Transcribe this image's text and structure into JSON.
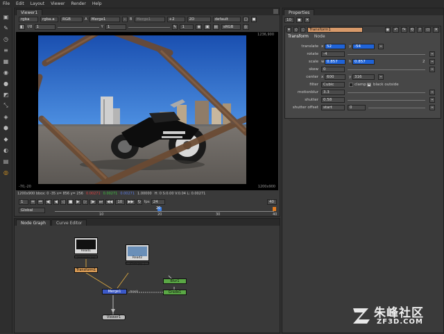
{
  "menu": [
    "File",
    "Edit",
    "Layout",
    "Viewer",
    "Render",
    "Help"
  ],
  "viewer": {
    "tab": "Viewer1",
    "channels": "rgba",
    "channel_a": "rgba.a",
    "colorspace": "RGB",
    "input_a_label": "A",
    "input_a": "Merge1",
    "input_b_label": "B",
    "input_b": "Merge1",
    "zoom": "+2",
    "view": "2D",
    "lut": "default",
    "gain_label": "f/8",
    "gain_value": "1",
    "gamma_label": "Y",
    "gamma_value": "1",
    "frame": "1",
    "display": "sRGB",
    "top_right_coord": "1236,900",
    "format_label": "1200x900",
    "bottom_left_coord": "-70,-20",
    "bottom_right_coord": "1200x900",
    "info_prefix": "1200x900 bbox: 0 -35  x= 856 y= 256",
    "info_r": "0.00271",
    "info_g": "0.00271",
    "info_b": "0.00271",
    "info_a": "1.00000",
    "info_suffix": "H:  0  S:0.00  V:0.04  L:  0.00271"
  },
  "timeline": {
    "range": "Global",
    "fps_label": "fps",
    "fps": "24",
    "step": "10",
    "current": "20",
    "start": "1",
    "end": "40",
    "ticks": [
      "10",
      "20",
      "30",
      "40"
    ]
  },
  "nodegraph": {
    "tabs": [
      "Node Graph",
      "Curve Editor"
    ],
    "nodes": {
      "read1": "Read1",
      "read1_sub": "(motorbike.jpg)",
      "read2": "Read2",
      "read2_sub": "(Chain.jpg...)",
      "transform": "Transform1",
      "merge": "Merge1",
      "blur": "Blur1",
      "grade": "Grade1",
      "viewer": "Viewer1",
      "mask_label": "mask"
    }
  },
  "properties": {
    "tab": "Properties",
    "max_panels": "10",
    "node_title": "Transform1",
    "subtabs": [
      "Transform",
      "Node"
    ],
    "translate_label": "translate",
    "translate_x_label": "x",
    "translate_x": "52",
    "translate_y_label": "y",
    "translate_y": "-54",
    "rotate_label": "rotate",
    "rotate": "-4",
    "scale_label": "scale",
    "scale_w_label": "w",
    "scale_w": "0.857",
    "scale_h_label": "h",
    "scale_h": "0.857",
    "scale_count": "2",
    "skew_label": "skew",
    "skew": "0",
    "center_label": "center",
    "center_x_label": "x",
    "center_x": "600",
    "center_y_label": "y",
    "center_y": "316",
    "filter_label": "filter",
    "filter": "Cubic",
    "clamp_label": "clamp",
    "black_outside_label": "black outside",
    "motionblur_label": "motionblur",
    "motionblur": "3.3",
    "shutter_label": "shutter",
    "shutter": "0.58",
    "shutter_offset_label": "shutter offset",
    "shutter_offset": "start",
    "shutter_offset_value": "0"
  },
  "watermark": {
    "name": "朱峰社区",
    "url": "ZF3D.COM"
  },
  "colors": {
    "accent_blue": "#1f63d8",
    "node_read": "#d8d8d8",
    "node_transform": "#d99b55",
    "node_merge": "#3b59c9",
    "node_grade": "#5aa845",
    "node_viewer": "#bbbbbb"
  }
}
